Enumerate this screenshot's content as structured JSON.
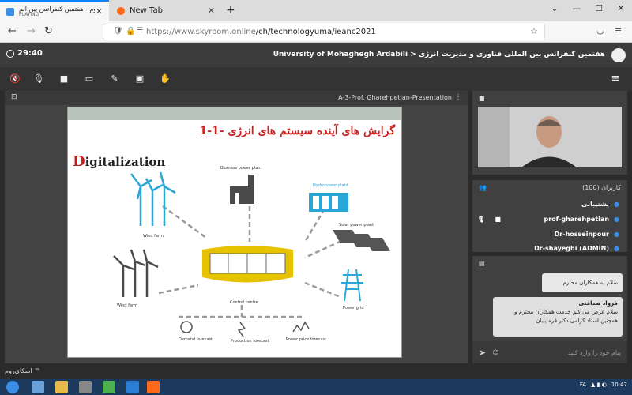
{
  "browser": {
    "tabs": [
      {
        "label": "اسکای‌روم - هفتمین کنفرانس بین الم",
        "sub": "PLAYING",
        "active": true
      },
      {
        "label": "New Tab",
        "active": false
      }
    ],
    "url_domain": "https://www.skyroom.online",
    "url_path": "/ch/technologyuma/ieanc2021"
  },
  "app": {
    "timer": "29:40",
    "room_title": "University of Mohaghegh Ardabili > هفتمین کنفرانس بین المللی فناوری و مدیریت انرژی"
  },
  "presentation": {
    "title": "A-3-Prof. Gharehpetian-Presentation",
    "slide": {
      "heading": "1-1- گرایش های آینده سیستم های انرژی",
      "digital_first": "D",
      "digital_rest": "igitalization",
      "labels": {
        "biomass": "Biomass power plant",
        "hydro": "Hydropower plant",
        "wind1": "Wind farm",
        "solar": "Solar power plant",
        "wind2": "Wind farm",
        "control": "Control centre",
        "grid": "Power grid",
        "demand": "Demand forecast",
        "production": "Production forecast",
        "price": "Power price forecast"
      }
    }
  },
  "users": {
    "title": "کاربران (100)",
    "list": [
      {
        "name": "پشتیبانی"
      },
      {
        "name": "prof-gharehpetian"
      },
      {
        "name": "Dr-hosseinpour"
      },
      {
        "name": "Dr-shayeghi (ADMIN)"
      }
    ]
  },
  "chat": {
    "messages": [
      {
        "author": "",
        "text": "سلام به همکاران محترم"
      },
      {
        "author": "فرواد صداقتی",
        "text": "سلام عرض می کنم خدمت همکاران محترم و همچنین استاد گرامی دکتر قره پتیان"
      }
    ],
    "input_placeholder": "پیام خود را وارد کنید"
  },
  "footer": {
    "brand": "اسکای‌روم ™"
  },
  "taskbar": {
    "lang": "FA",
    "time": "10:47"
  },
  "colors": {
    "accent": "#0a84ff",
    "title_red": "#cc1f1f",
    "user_blue": "#3a8ee6",
    "control_yellow": "#e6c200",
    "turbine_blue": "#2aa7d6"
  }
}
